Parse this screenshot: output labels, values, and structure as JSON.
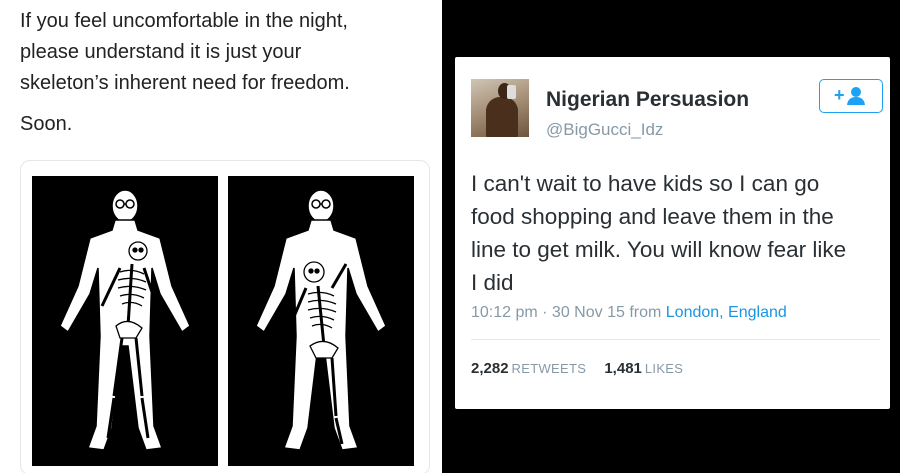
{
  "left_post": {
    "lines": [
      "If you feel uncomfortable in the night,",
      "please understand it is just your",
      "skeleton’s inherent need for freedom."
    ],
    "closing": "Soon."
  },
  "tweet": {
    "author_name": "Nigerian Persuasion",
    "handle": "@BigGucci_Idz",
    "follow_icon": "add-user-icon",
    "text_lines": [
      "I can't wait to have kids so I can go",
      "food shopping and leave them in the",
      "line to get milk. You will know fear like",
      "I did"
    ],
    "time": "10:12 pm · 30 Nov 15 from",
    "location": "London, England",
    "retweets_count": "2,282",
    "retweets_label": "RETWEETS",
    "likes_count": "1,481",
    "likes_label": "LIKES",
    "link_color": "#1b95e0"
  }
}
